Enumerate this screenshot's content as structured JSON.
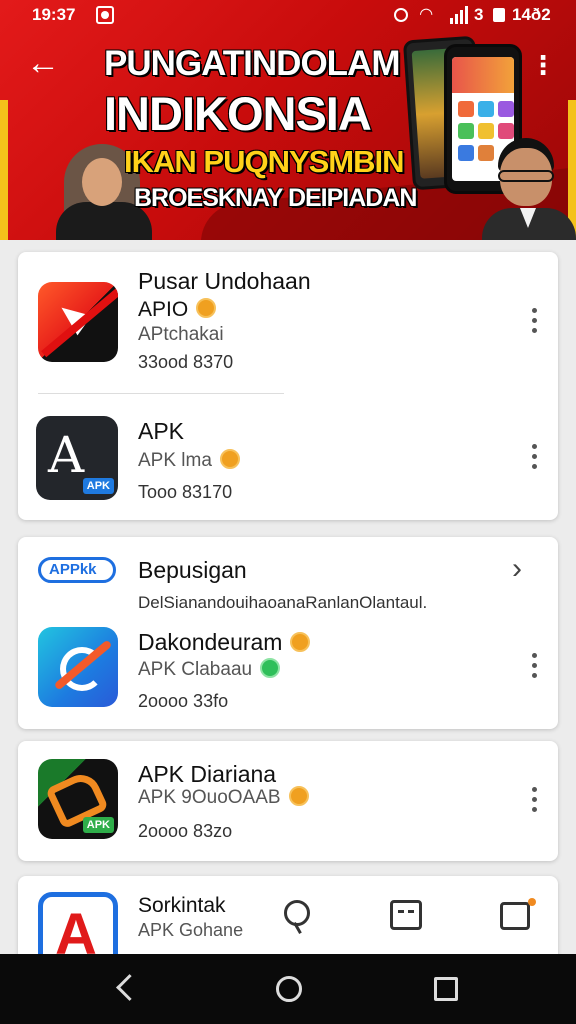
{
  "status_bar": {
    "time": "19:37",
    "extra": "3",
    "battery": "14ð2"
  },
  "banner": {
    "line1": "PUNGATINDOLAM",
    "line2": "INDIKONSIA",
    "line3": "IKAN PUQNYSMBIN",
    "line4": "BROESKNAY DEIPIADAN"
  },
  "apps_card_1": [
    {
      "title": "Pusar Undohaan",
      "subtitle_1": "APIO",
      "subtitle_2": "APtchakai",
      "size": "33ood 8370",
      "icon": "orange-arrow-app-icon"
    },
    {
      "title": "APK",
      "subtitle_1": "APK lma",
      "size": "Tooo 83170",
      "icon": "black-a-app-icon"
    }
  ],
  "section": {
    "logo": "APPkk",
    "title": "Bepusigan",
    "description": "DelSianandouihaoanaRanlanOlantaul.",
    "app": {
      "title": "Dakondeuram",
      "subtitle": "APK Clabaau",
      "size": "2oooo 33fo",
      "icon": "blue-gradient-app-icon"
    }
  },
  "apps_card_3": {
    "title": "APK Diariana",
    "subtitle": "APK 9OuoOAAB",
    "size": "2oooo 83zo",
    "icon": "green-black-app-icon"
  },
  "apps_card_4": {
    "title": "Sorkintak",
    "subtitle": "APK Gohane",
    "icon": "blue-a-app-icon"
  },
  "icons": {
    "toolbar": [
      "search-icon",
      "chat-icon",
      "notice-icon"
    ],
    "nav": [
      "nav-back-icon",
      "nav-home-icon",
      "nav-recents-icon"
    ]
  },
  "colors": {
    "banner_red": "#d11212",
    "banner_gold": "#ffd21a",
    "badge_orange": "#f0a020",
    "badge_green": "#2fbf5a",
    "accent_blue": "#1e6fe0"
  }
}
